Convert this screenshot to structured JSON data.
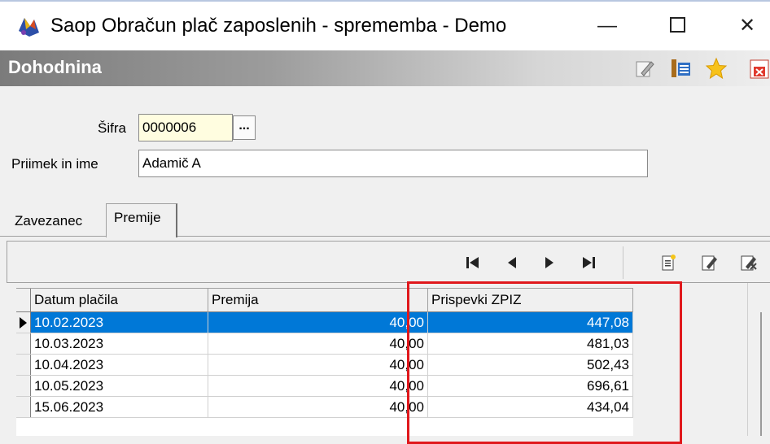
{
  "window": {
    "title": "Saop  Obračun plač zaposlenih - sprememba - Demo",
    "minimize_glyph": "—",
    "close_glyph": "✕"
  },
  "header": {
    "title": "Dohodnina",
    "icons": [
      "edit-icon",
      "list-icon",
      "star-icon",
      "close-doc-icon"
    ]
  },
  "form": {
    "sifra_label": "Šifra",
    "sifra_value": "0000006",
    "lookup_label": "...",
    "name_label": "Priimek in ime",
    "name_value": "Adamič A"
  },
  "tabs": [
    {
      "label": "Zavezanec",
      "active": false
    },
    {
      "label": "Premije",
      "active": true
    }
  ],
  "toolbar": {
    "nav_icons": [
      "first-record-icon",
      "prev-record-icon",
      "next-record-icon",
      "last-record-icon"
    ],
    "action_icons": [
      "new-record-icon",
      "edit-record-icon",
      "delete-record-icon"
    ]
  },
  "grid": {
    "columns": [
      "Datum plačila",
      "Premija",
      "Prispevki ZPIZ"
    ],
    "rows": [
      {
        "date": "10.02.2023",
        "premija": "40,00",
        "zpiz": "447,08",
        "selected": true
      },
      {
        "date": "10.03.2023",
        "premija": "40,00",
        "zpiz": "481,03",
        "selected": false
      },
      {
        "date": "10.04.2023",
        "premija": "40,00",
        "zpiz": "502,43",
        "selected": false
      },
      {
        "date": "10.05.2023",
        "premija": "40,00",
        "zpiz": "696,61",
        "selected": false
      },
      {
        "date": "15.06.2023",
        "premija": "40,00",
        "zpiz": "434,04",
        "selected": false
      }
    ]
  },
  "colors": {
    "selection": "#0078d7",
    "highlight": "#e0181c",
    "header_gradient_start": "#7b7b7b"
  }
}
